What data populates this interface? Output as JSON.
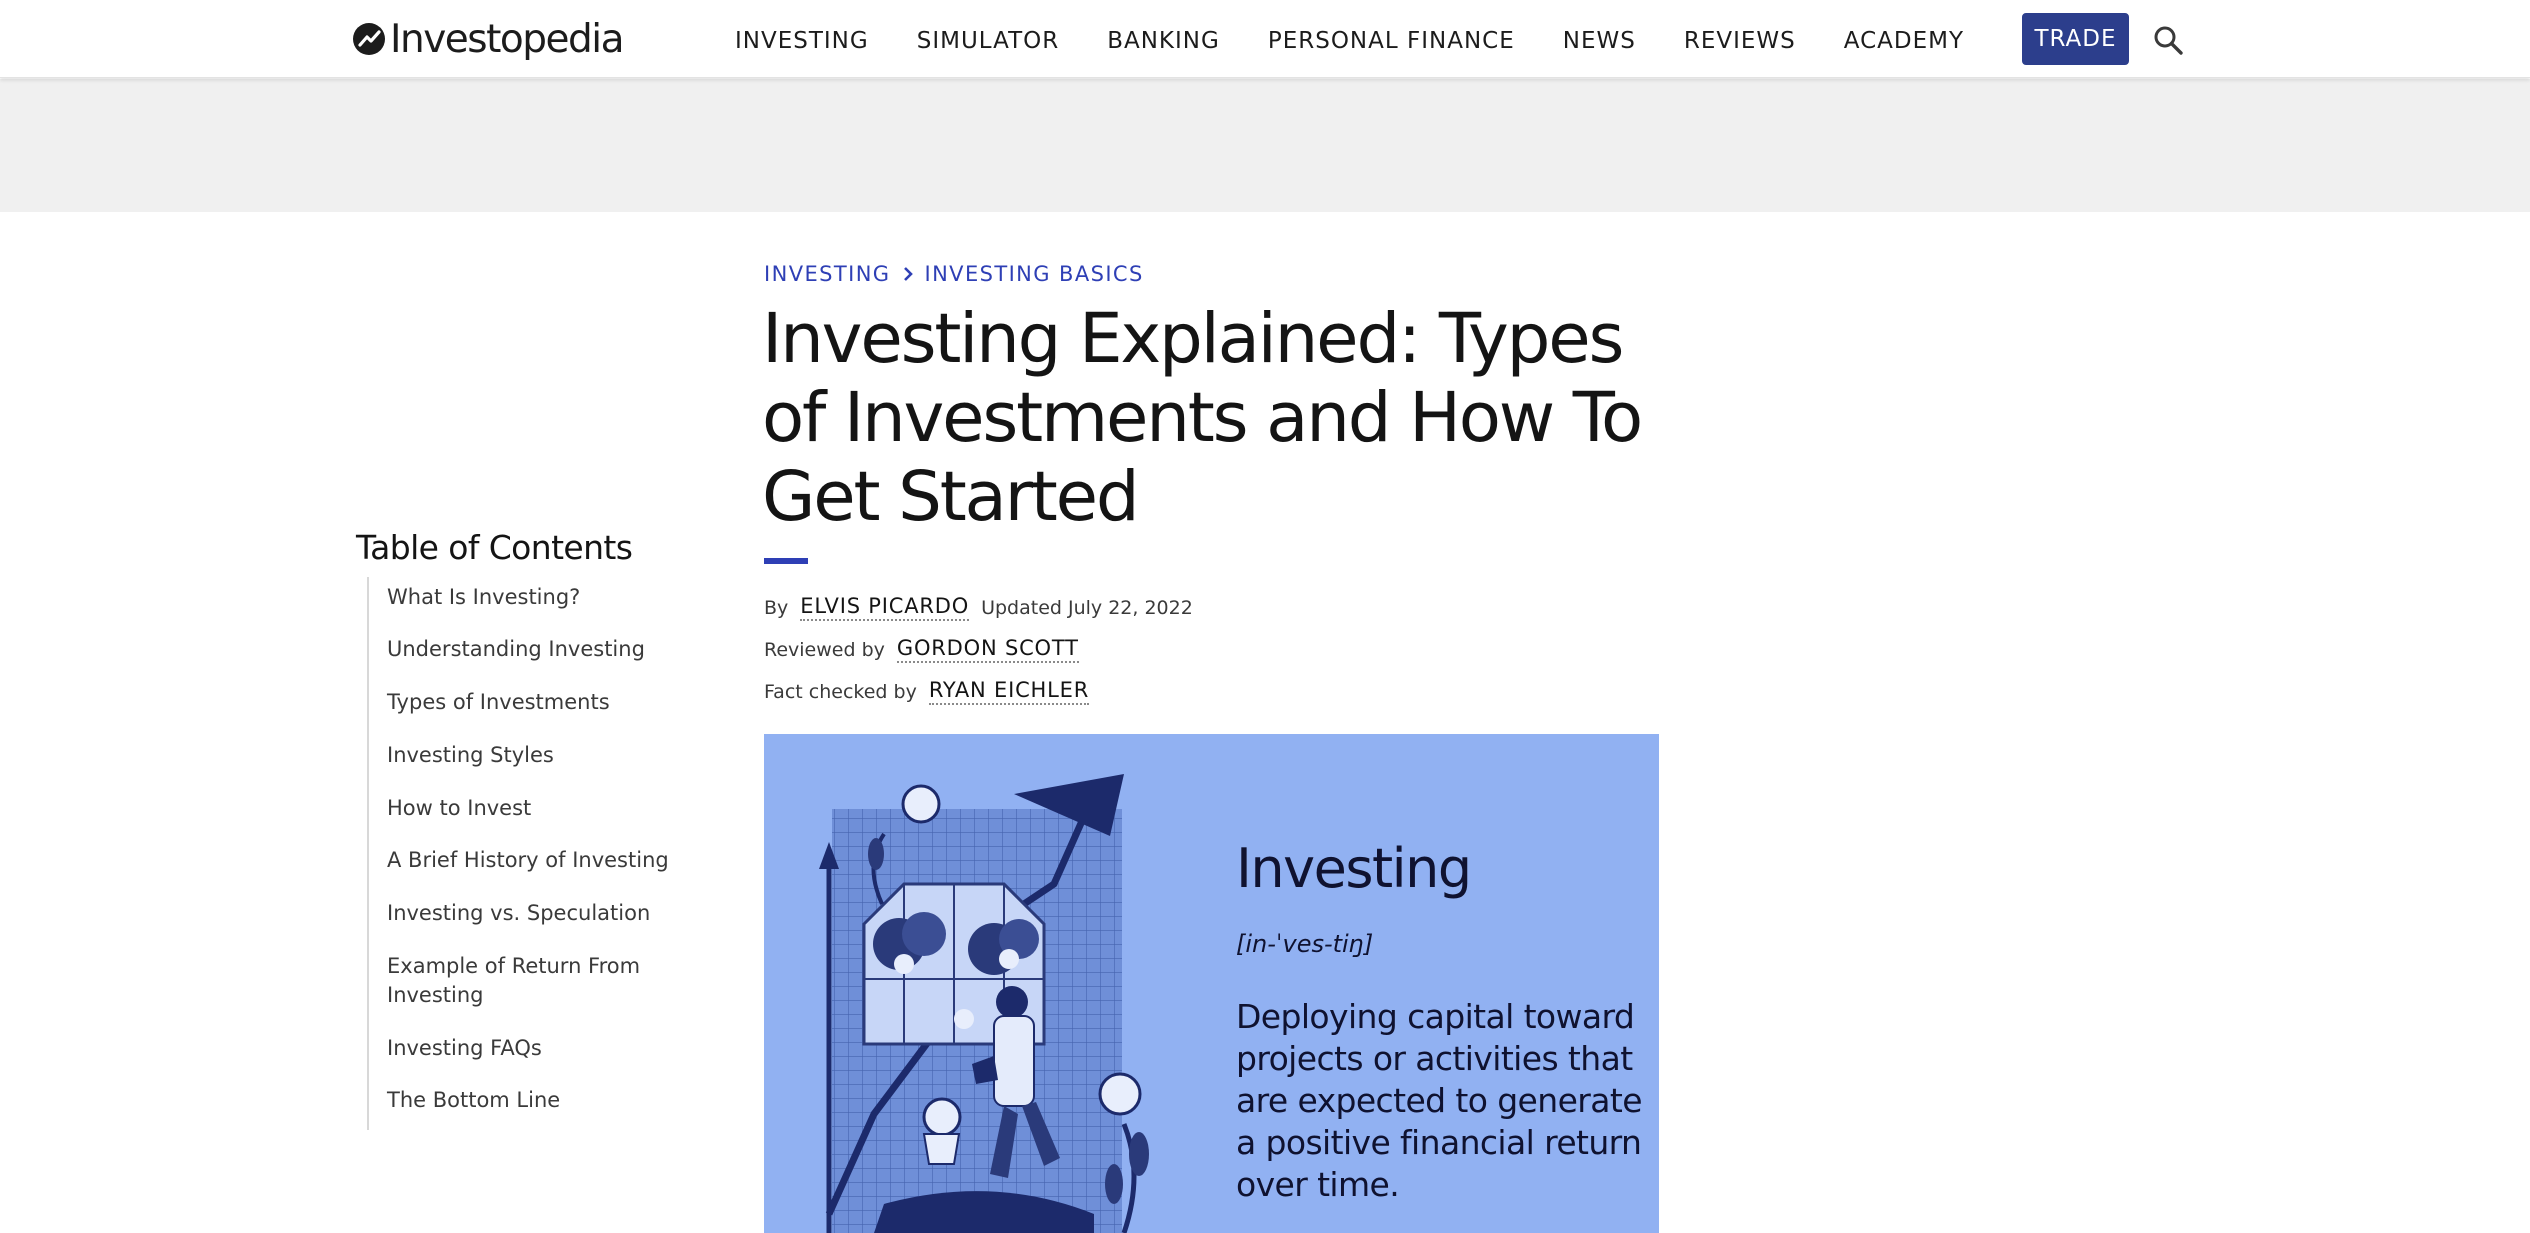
{
  "header": {
    "logo_text": "Investopedia",
    "nav": [
      "INVESTING",
      "SIMULATOR",
      "BANKING",
      "PERSONAL FINANCE",
      "NEWS",
      "REVIEWS",
      "ACADEMY"
    ],
    "trade_label": "TRADE",
    "search_icon": "search-icon"
  },
  "breadcrumb": [
    "INVESTING",
    "INVESTING BASICS"
  ],
  "article": {
    "title": "Investing Explained: Types of Investments and How To Get Started",
    "by_label": "By",
    "author": "ELVIS PICARDO",
    "updated": "Updated July 22, 2022",
    "reviewed_label": "Reviewed by",
    "reviewer": "GORDON SCOTT",
    "factcheck_label": "Fact checked by",
    "fact_checker": "RYAN EICHLER"
  },
  "toc": {
    "title": "Table of Contents",
    "items": [
      "What Is Investing?",
      "Understanding Investing",
      "Types of Investments",
      "Investing Styles",
      "How to Invest",
      "A Brief History of Investing",
      "Investing vs. Speculation",
      "Example of Return From Investing",
      "Investing FAQs",
      "The Bottom Line"
    ]
  },
  "hero": {
    "word": "Investing",
    "pronunciation": "[in-ˈves-tiŋ]",
    "definition": "Deploying capital toward projects or activities that are expected to generate a positive financial return over time."
  },
  "colors": {
    "accent": "#2e3fb5",
    "trade_button": "#2c3e8c",
    "hero_bg": "#91b1f2",
    "ad_band": "#f0f0f0"
  }
}
